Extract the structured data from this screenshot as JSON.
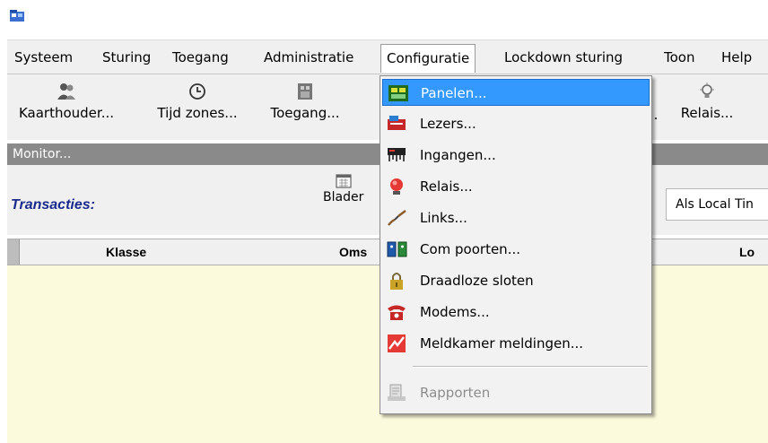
{
  "menubar": {
    "items": [
      "Systeem",
      "Sturing",
      "Toegang",
      "Administratie",
      "Configuratie",
      "Lockdown sturing",
      "Toon",
      "Help"
    ]
  },
  "toolbar": {
    "buttons": [
      {
        "label": "Kaarthouder...",
        "icon": "users-icon"
      },
      {
        "label": "Tijd zones...",
        "icon": "clock-icon"
      },
      {
        "label": "Toegang...",
        "icon": "door-access-icon"
      },
      {
        "label": ".",
        "icon": ""
      },
      {
        "label": "Relais...",
        "icon": "lightbulb-icon"
      }
    ]
  },
  "monitor": {
    "title": "Monitor..."
  },
  "transactions": {
    "title": "Transacties:",
    "browse_label": "Blader",
    "time_mode": "Als Local Tin"
  },
  "grid": {
    "columns": [
      "Klasse",
      "Oms",
      "Lo"
    ]
  },
  "dropdown": {
    "items": [
      {
        "label": "Panelen...",
        "icon": "panel-icon",
        "highlighted": true,
        "enabled": true
      },
      {
        "label": "Lezers...",
        "icon": "reader-icon",
        "enabled": true
      },
      {
        "label": "Ingangen...",
        "icon": "input-icon",
        "enabled": true
      },
      {
        "label": "Relais...",
        "icon": "relay-icon",
        "enabled": true
      },
      {
        "label": "Links...",
        "icon": "link-icon",
        "enabled": true
      },
      {
        "label": "Com poorten...",
        "icon": "com-port-icon",
        "enabled": true
      },
      {
        "label": "Draadloze sloten",
        "icon": "padlock-icon",
        "enabled": true
      },
      {
        "label": "Modems...",
        "icon": "telephone-icon",
        "enabled": true
      },
      {
        "label": "Meldkamer meldingen...",
        "icon": "alarm-icon",
        "enabled": true
      },
      {
        "label": "Rapporten",
        "icon": "report-icon",
        "enabled": false
      }
    ]
  },
  "colors": {
    "highlight": "#3399ff",
    "grid_background": "#fcfadc",
    "monitor_bar": "#8a8a8a",
    "transactions_title": "#1a2a8c"
  }
}
